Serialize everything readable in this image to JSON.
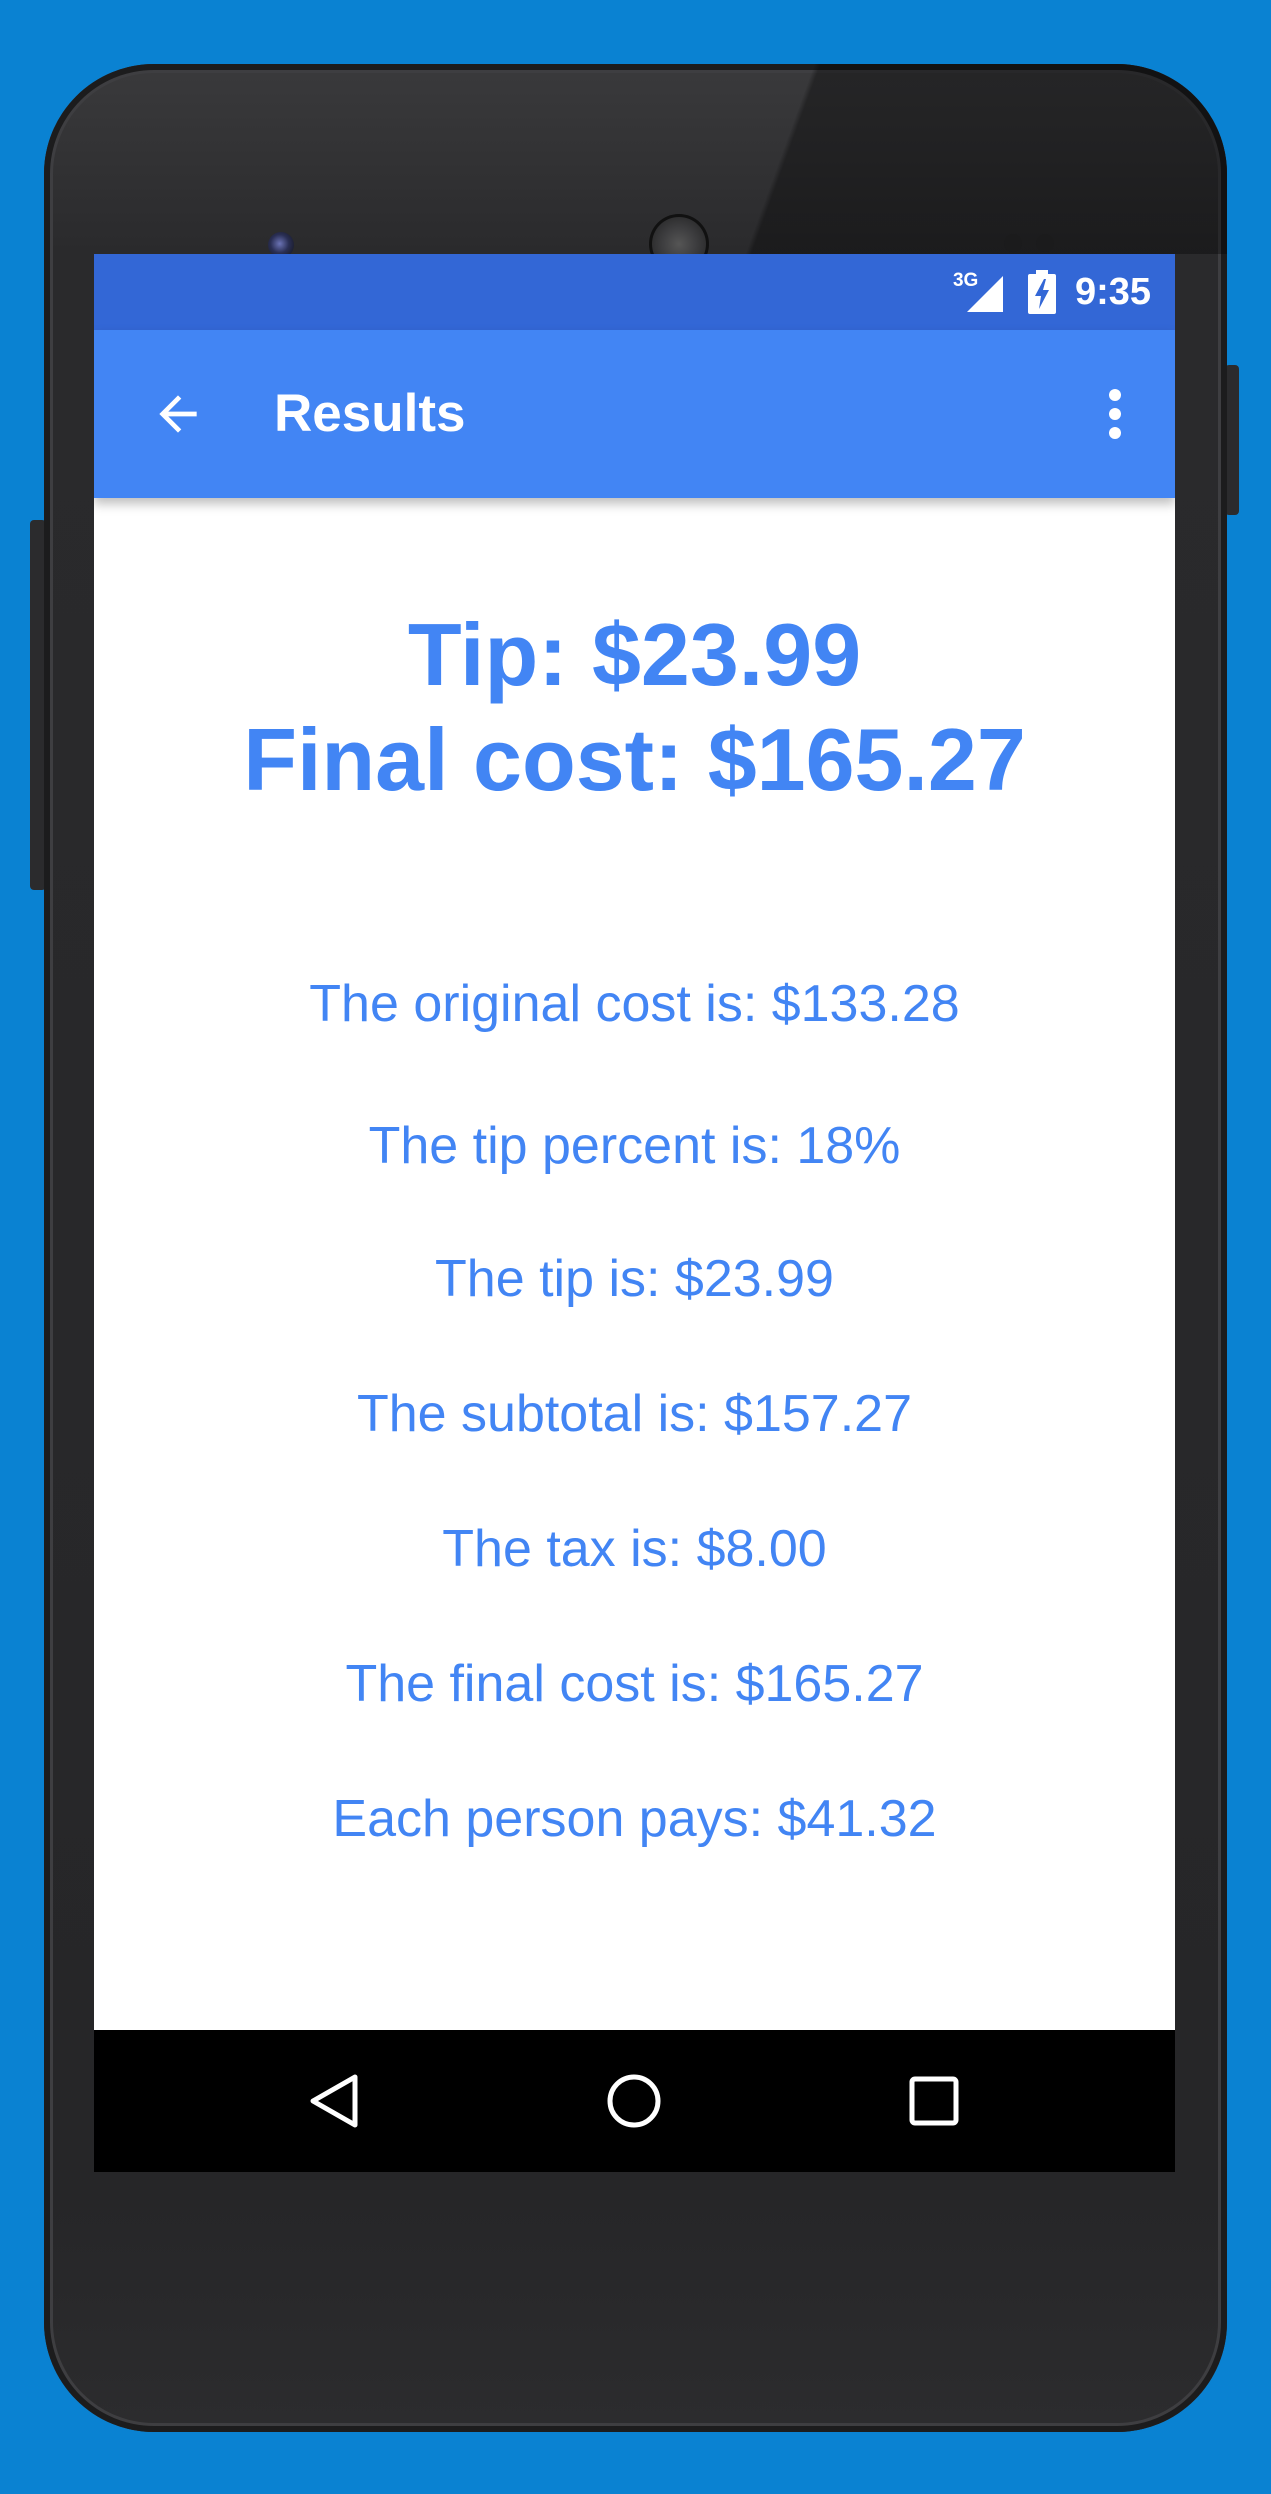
{
  "status_bar": {
    "network": "3G",
    "time": "9:35"
  },
  "app_bar": {
    "title": "Results",
    "back_icon": "arrow-back-icon",
    "menu_icon": "more-vert-icon"
  },
  "summary": {
    "tip": "Tip: $23.99",
    "final_cost": "Final cost: $165.27"
  },
  "details": [
    "The original cost is: $133.28",
    "The tip percent is: 18%",
    "The tip is: $23.99",
    "The subtotal is: $157.27",
    "The tax is: $8.00",
    "The final cost is: $165.27",
    "Each person pays: $41.32"
  ],
  "nav_bar": {
    "back_icon": "nav-back-triangle-icon",
    "home_icon": "nav-home-circle-icon",
    "recents_icon": "nav-recents-square-icon"
  },
  "colors": {
    "background": "#0a82d2",
    "status_bar": "#3367d6",
    "app_bar": "#4285f4",
    "accent_text": "#4285f4"
  }
}
